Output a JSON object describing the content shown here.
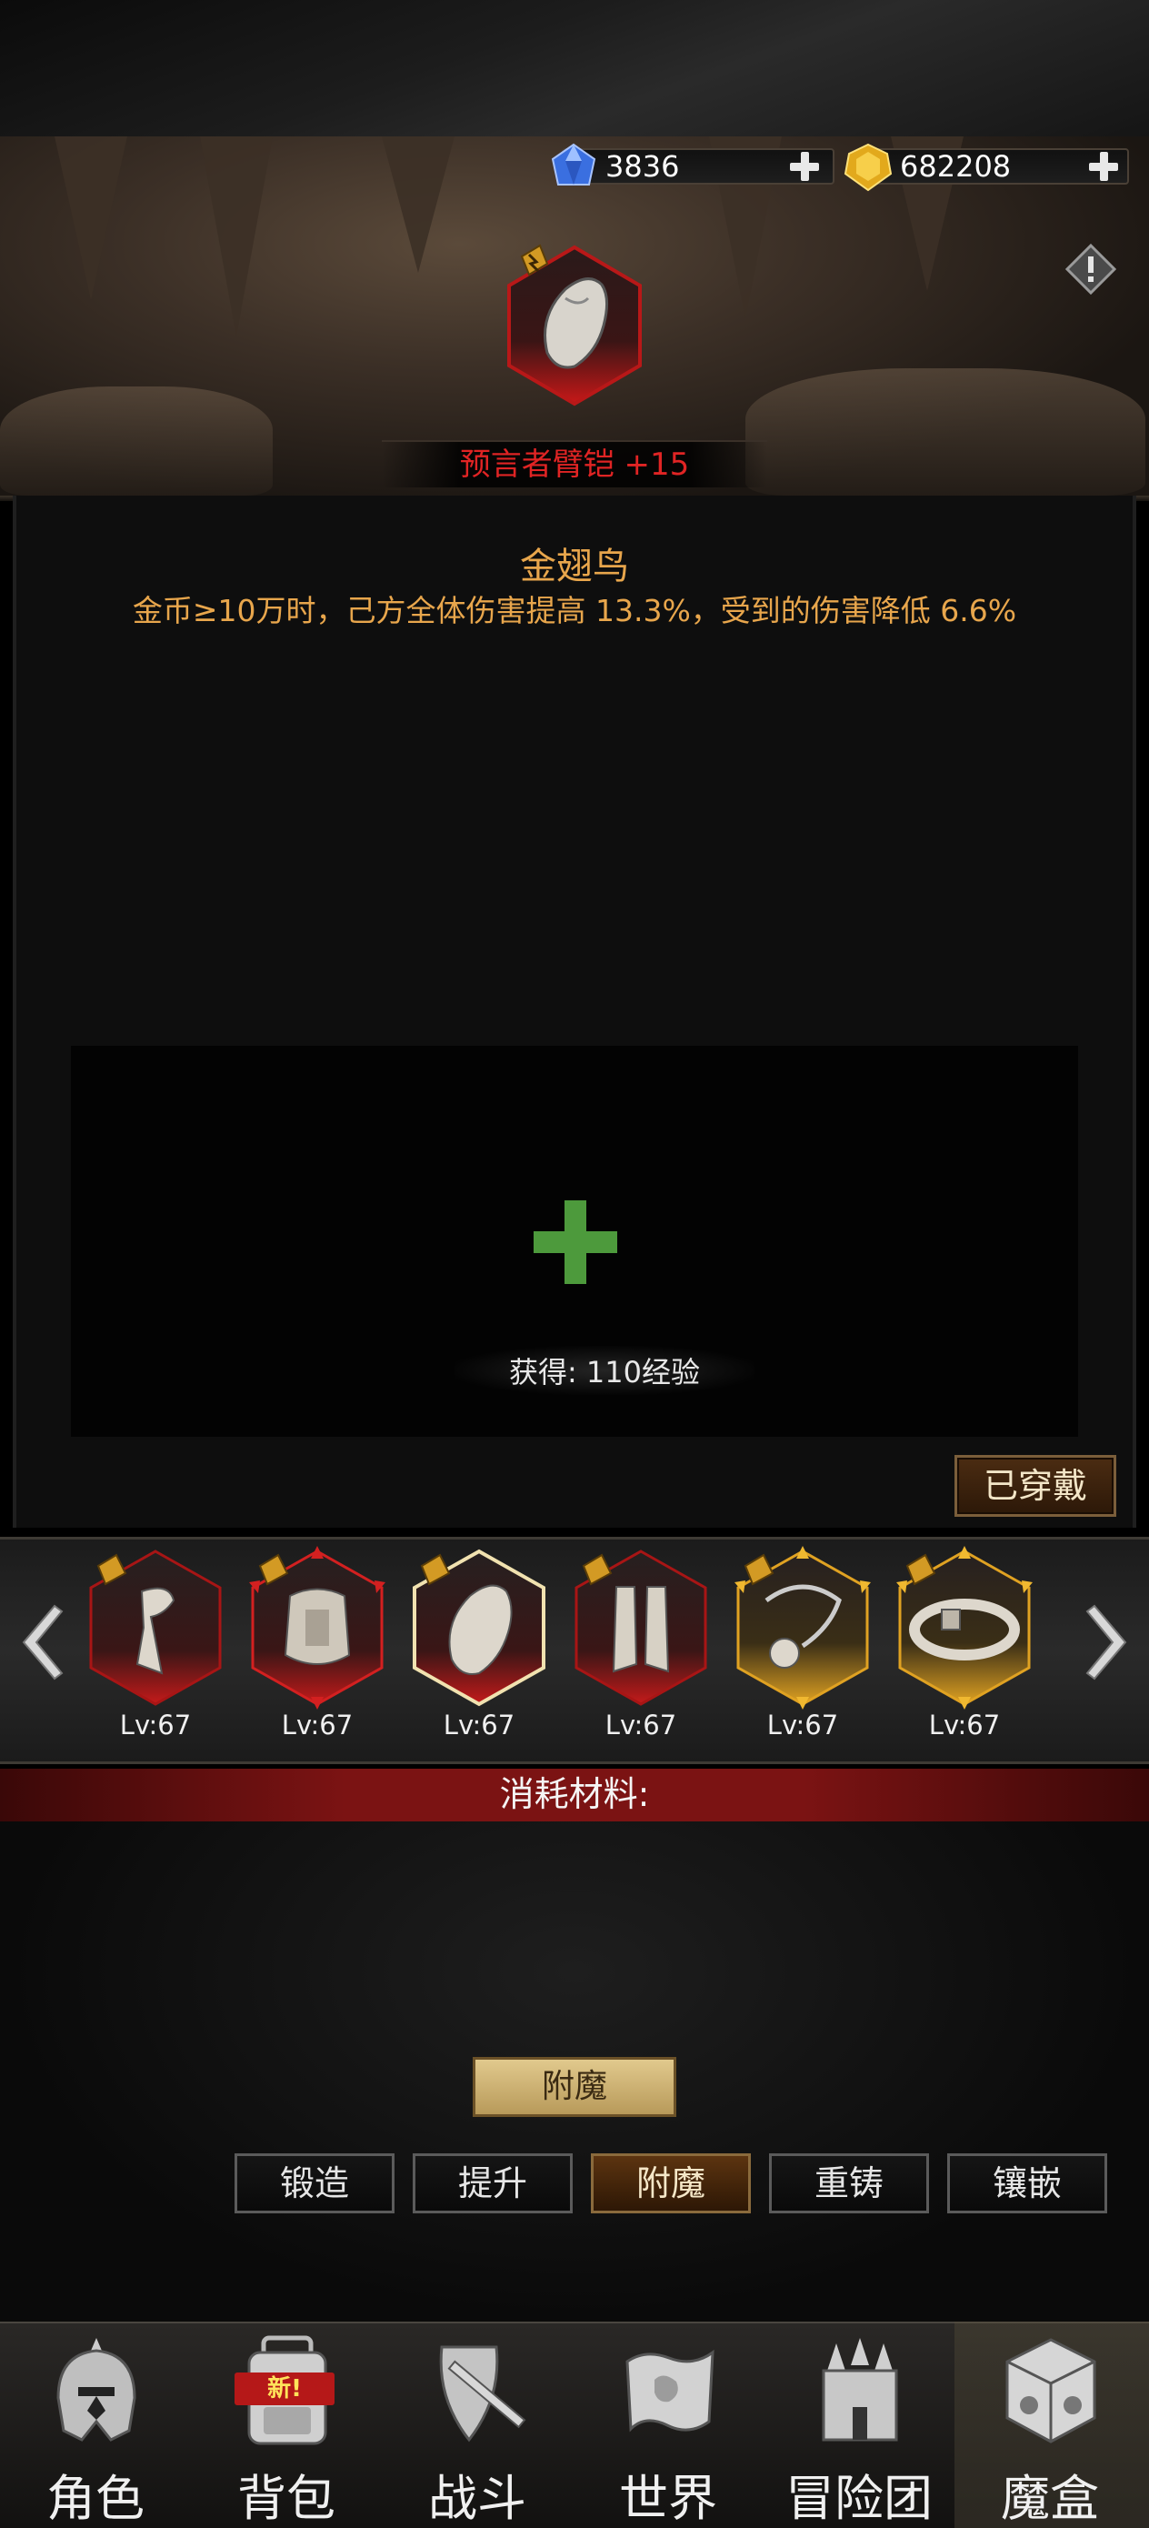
{
  "currency": {
    "gems": "3836",
    "gold": "682208"
  },
  "item": {
    "name": "预言者臂铠 +15"
  },
  "enchant": {
    "name": "金翅鸟",
    "description": "金币≥10万时，己方全体伤害提高 13.3%，受到的伤害降低 6.6%"
  },
  "drop": {
    "gain_text": "获得: 110经验"
  },
  "equipped_label": "已穿戴",
  "equipment_slots": [
    {
      "icon": "scarf-icon",
      "level": "Lv:67",
      "frame": "red"
    },
    {
      "icon": "chest-armor-icon",
      "level": "Lv:67",
      "frame": "red"
    },
    {
      "icon": "gauntlet-icon",
      "level": "Lv:67",
      "frame": "red",
      "selected": true
    },
    {
      "icon": "greaves-icon",
      "level": "Lv:67",
      "frame": "red"
    },
    {
      "icon": "necklace-icon",
      "level": "Lv:67",
      "frame": "gold"
    },
    {
      "icon": "belt-icon",
      "level": "Lv:67",
      "frame": "gold"
    }
  ],
  "materials_label": "消耗材料:",
  "action_button": "附魔",
  "tabs": [
    {
      "label": "锻造",
      "active": false
    },
    {
      "label": "提升",
      "active": false
    },
    {
      "label": "附魔",
      "active": true
    },
    {
      "label": "重铸",
      "active": false
    },
    {
      "label": "镶嵌",
      "active": false
    }
  ],
  "nav": [
    {
      "label": "角色",
      "icon": "helmet-icon"
    },
    {
      "label": "背包",
      "icon": "backpack-icon",
      "badge": "新!"
    },
    {
      "label": "战斗",
      "icon": "shield-sword-icon"
    },
    {
      "label": "世界",
      "icon": "map-scroll-icon"
    },
    {
      "label": "冒险团",
      "icon": "castle-icon"
    },
    {
      "label": "魔盒",
      "icon": "magic-cube-icon",
      "active": true
    }
  ],
  "colors": {
    "item_name": "#e02424",
    "enchant_text": "#e8a64c",
    "green_plus": "#4d9a3c",
    "material_bar": "#7b1313",
    "active_tab": "#5c3410"
  }
}
